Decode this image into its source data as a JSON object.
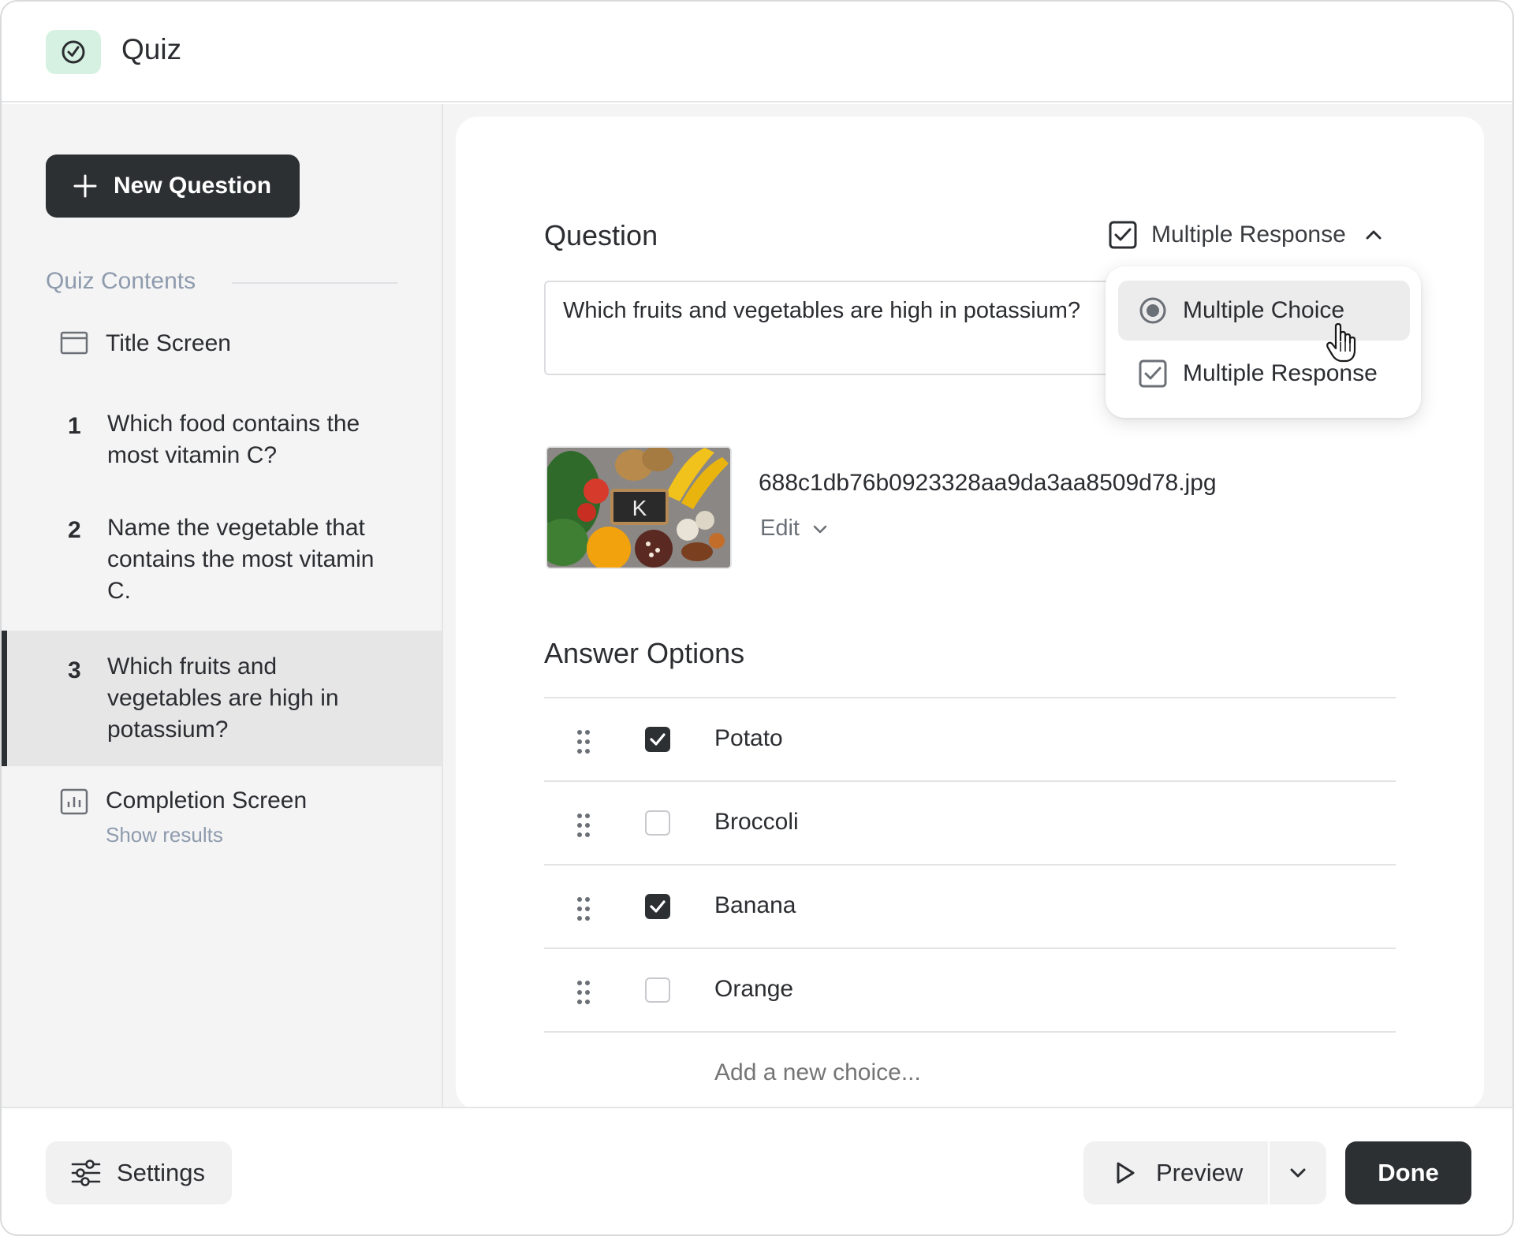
{
  "header": {
    "app_title": "Quiz",
    "app_icon": "check-circle-icon"
  },
  "sidebar": {
    "new_question_label": "New Question",
    "contents_heading": "Quiz Contents",
    "items": [
      {
        "type": "title",
        "label": "Title Screen",
        "icon": "title-screen-icon"
      },
      {
        "number": "1",
        "label": "Which food contains the most vitamin C?"
      },
      {
        "number": "2",
        "label": "Name the vegetable that contains the most vitamin C."
      },
      {
        "number": "3",
        "label": "Which fruits and vegetables are high in potassium?",
        "active": true
      },
      {
        "type": "completion",
        "label": "Completion Screen",
        "sub_label": "Show results",
        "icon": "bar-chart-icon"
      }
    ]
  },
  "editor": {
    "question_label": "Question",
    "question_type": "Multiple Response",
    "question_text": "Which fruits and vegetables are high in potassium?",
    "image": {
      "file_name": "688c1db76b0923328aa9da3aa8509d78.jpg",
      "edit_label": "Edit",
      "tile_letter": "K"
    },
    "answers_heading": "Answer Options",
    "answers": [
      {
        "text": "Potato",
        "checked": true
      },
      {
        "text": "Broccoli",
        "checked": false
      },
      {
        "text": "Banana",
        "checked": true
      },
      {
        "text": "Orange",
        "checked": false
      }
    ],
    "add_choice_placeholder": "Add a new choice..."
  },
  "type_dropdown": {
    "options": [
      {
        "label": "Multiple Choice",
        "icon": "radio-icon",
        "hovered": true
      },
      {
        "label": "Multiple Response",
        "icon": "checkbox-icon",
        "hovered": false
      }
    ]
  },
  "footer": {
    "settings_label": "Settings",
    "preview_label": "Preview",
    "done_label": "Done"
  },
  "colors": {
    "primary_dark": "#2d3033",
    "accent_green_bg": "#d6f1e2",
    "muted_text": "#8e9bad"
  }
}
